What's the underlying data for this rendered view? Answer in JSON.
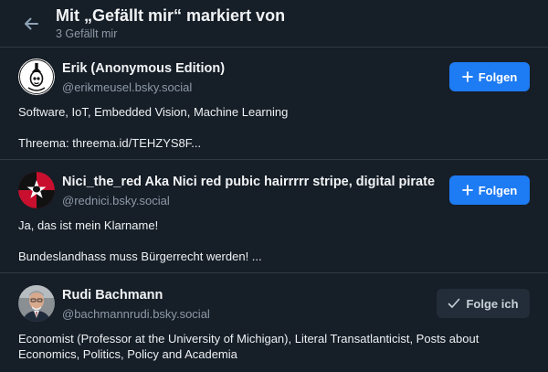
{
  "header": {
    "title": "Mit „Gefällt mir“ markiert von",
    "subtitle": "3 Gefällt mir",
    "back_icon": "arrow-left-icon"
  },
  "users": [
    {
      "name": "Erik (Anonymous Edition)",
      "handle": "@erikmeusel.bsky.social",
      "bio": [
        "Software, IoT, Embedded Vision, Machine Learning",
        "Threema: threema.id/TEHZYS8F..."
      ],
      "button_label": "Folgen",
      "button_icon": "plus-icon",
      "following": false
    },
    {
      "name": "Nici_the_red Aka Nici red pubic hairrrrr stripe, digital pirate",
      "handle": "@rednici.bsky.social",
      "bio": [
        "Ja, das ist mein Klarname!",
        "Bundeslandhass muss Bürgerrecht werden! ..."
      ],
      "button_label": "Folgen",
      "button_icon": "plus-icon",
      "following": false
    },
    {
      "name": "Rudi Bachmann",
      "handle": "@bachmannrudi.bsky.social",
      "bio": [
        "Economist (Professor at the University of Michigan), Literal Transatlanticist, Posts about Economics, Politics, Policy and Academia"
      ],
      "button_label": "Folge ich",
      "button_icon": "check-icon",
      "following": true
    }
  ],
  "colors": {
    "background": "#161e27",
    "accent": "#1d7bf3",
    "divider": "#2e3a46",
    "muted_text": "#8d9aa8"
  }
}
